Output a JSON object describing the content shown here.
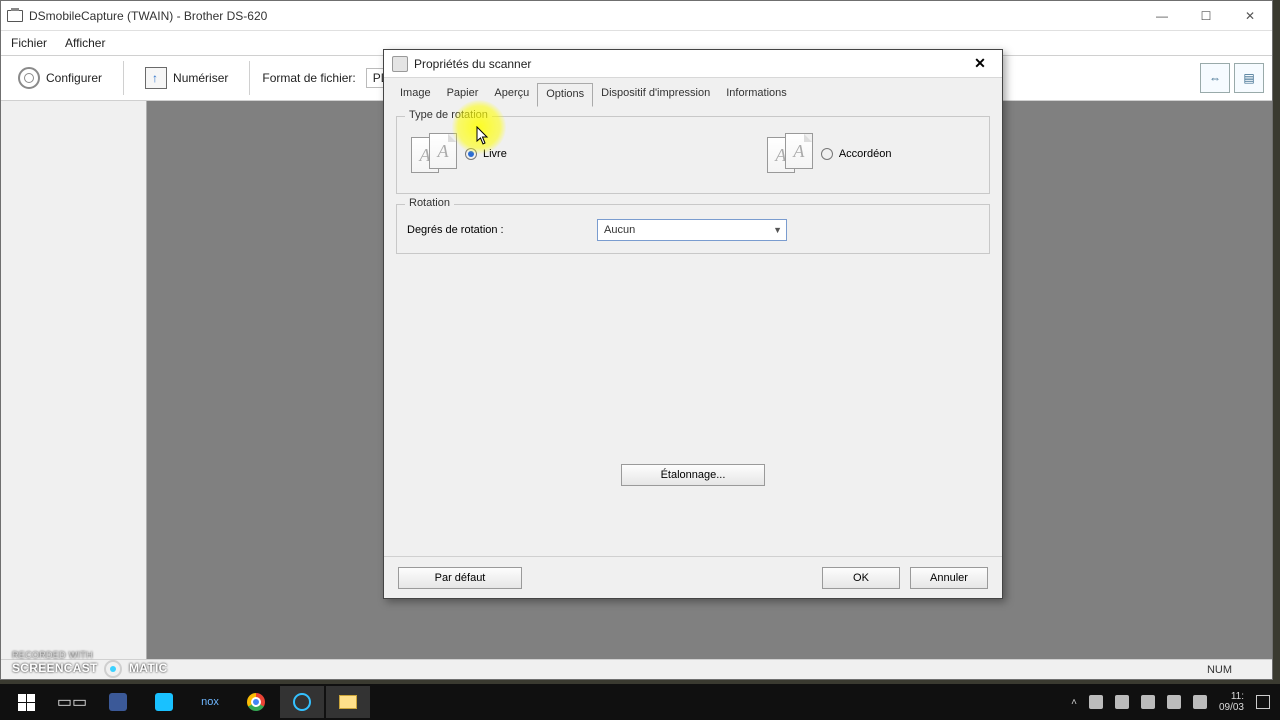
{
  "app": {
    "title": "DSmobileCapture (TWAIN) - Brother DS-620",
    "menu": {
      "fichier": "Fichier",
      "afficher": "Afficher"
    },
    "toolbar": {
      "configurer": "Configurer",
      "numeriser": "Numériser",
      "format_label": "Format de fichier:",
      "format_value": "PD"
    },
    "status": {
      "num": "NUM"
    }
  },
  "dialog": {
    "title": "Propriétés du scanner",
    "tabs": {
      "image": "Image",
      "papier": "Papier",
      "apercu": "Aperçu",
      "options": "Options",
      "dispositif": "Dispositif d'impression",
      "informations": "Informations"
    },
    "group_type": {
      "legend": "Type de rotation",
      "livre": "Livre",
      "accordeon": "Accordéon"
    },
    "group_rotation": {
      "legend": "Rotation",
      "degres_label": "Degrés de rotation :",
      "degres_value": "Aucun"
    },
    "etalonnage": "Étalonnage...",
    "buttons": {
      "defaut": "Par défaut",
      "ok": "OK",
      "annuler": "Annuler"
    }
  },
  "taskbar": {
    "time": "11:",
    "date": "09/03"
  },
  "watermark": {
    "top": "RECORDED WITH",
    "left": "SCREENCAST",
    "right": "MATIC"
  }
}
